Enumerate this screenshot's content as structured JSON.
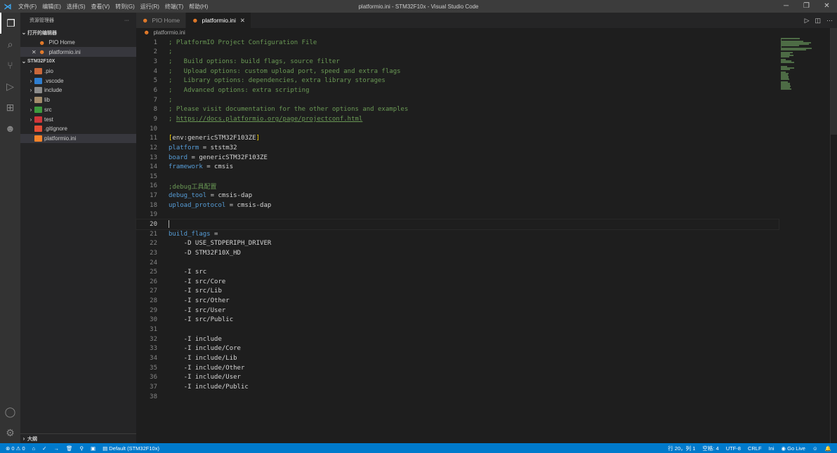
{
  "window": {
    "title": "platformio.ini - STM32F10x - Visual Studio Code",
    "menu": [
      "文件(F)",
      "编辑(E)",
      "选择(S)",
      "查看(V)",
      "转到(G)",
      "运行(R)",
      "终端(T)",
      "帮助(H)"
    ]
  },
  "sidebar": {
    "title": "资源管理器",
    "more": "···",
    "open_editors": "打开的编辑器",
    "open_items": [
      "PIO Home",
      "platformio.ini"
    ],
    "project": "STM32F10X",
    "tree": [
      {
        "label": ".pio",
        "folder": true,
        "color": "#c9683b"
      },
      {
        "label": ".vscode",
        "folder": true,
        "color": "#2f7fd1"
      },
      {
        "label": "include",
        "folder": true,
        "color": "#8c8c8c"
      },
      {
        "label": "lib",
        "folder": true,
        "color": "#a38c6c"
      },
      {
        "label": "src",
        "folder": true,
        "color": "#3e9a3e"
      },
      {
        "label": "test",
        "folder": true,
        "color": "#d0363a"
      },
      {
        "label": ".gitignore",
        "folder": false,
        "color": "#e44d34"
      },
      {
        "label": "platformio.ini",
        "folder": false,
        "color": "#f5822a"
      }
    ],
    "outline": "大纲"
  },
  "tabs": [
    {
      "label": "PIO Home",
      "active": false
    },
    {
      "label": "platformio.ini",
      "active": true
    }
  ],
  "breadcrumb": "platformio.ini",
  "code": [
    [
      [
        "c",
        "; PlatformIO Project Configuration File"
      ]
    ],
    [
      [
        "c",
        ";"
      ]
    ],
    [
      [
        "c",
        ";   Build options: build flags, source filter"
      ]
    ],
    [
      [
        "c",
        ";   Upload options: custom upload port, speed and extra flags"
      ]
    ],
    [
      [
        "c",
        ";   Library options: dependencies, extra library storages"
      ]
    ],
    [
      [
        "c",
        ";   Advanced options: extra scripting"
      ]
    ],
    [
      [
        "c",
        ";"
      ]
    ],
    [
      [
        "c",
        "; Please visit documentation for the other options and examples"
      ]
    ],
    [
      [
        "c",
        "; "
      ],
      [
        "u",
        "https://docs.platformio.org/page/projectconf.html"
      ]
    ],
    [],
    [
      [
        "b",
        "["
      ],
      [
        "v",
        "env:genericSTM32F103ZE"
      ],
      [
        "b",
        "]"
      ]
    ],
    [
      [
        "k",
        "platform"
      ],
      [
        "v",
        " = ststm32"
      ]
    ],
    [
      [
        "k",
        "board"
      ],
      [
        "v",
        " = genericSTM32F103ZE"
      ]
    ],
    [
      [
        "k",
        "framework"
      ],
      [
        "v",
        " = cmsis"
      ]
    ],
    [],
    [
      [
        "c",
        ";debug工具配置"
      ]
    ],
    [
      [
        "k",
        "debug_tool"
      ],
      [
        "v",
        " = cmsis-dap"
      ]
    ],
    [
      [
        "k",
        "upload_protocol"
      ],
      [
        "v",
        " = cmsis-dap"
      ]
    ],
    [],
    [],
    [
      [
        "k",
        "build_flags"
      ],
      [
        "v",
        " ="
      ]
    ],
    [
      [
        "v",
        "    -D USE_STDPERIPH_DRIVER"
      ]
    ],
    [
      [
        "v",
        "    -D STM32F10X_HD"
      ]
    ],
    [],
    [
      [
        "v",
        "    -I src"
      ]
    ],
    [
      [
        "v",
        "    -I src/Core"
      ]
    ],
    [
      [
        "v",
        "    -I src/Lib"
      ]
    ],
    [
      [
        "v",
        "    -I src/Other"
      ]
    ],
    [
      [
        "v",
        "    -I src/User"
      ]
    ],
    [
      [
        "v",
        "    -I src/Public"
      ]
    ],
    [],
    [
      [
        "v",
        "    -I include"
      ]
    ],
    [
      [
        "v",
        "    -I include/Core"
      ]
    ],
    [
      [
        "v",
        "    -I include/Lib"
      ]
    ],
    [
      [
        "v",
        "    -I include/Other"
      ]
    ],
    [
      [
        "v",
        "    -I include/User"
      ]
    ],
    [
      [
        "v",
        "    -I include/Public"
      ]
    ],
    []
  ],
  "cursor_line": 20,
  "status": {
    "errors": "0",
    "warnings": "0",
    "env": "Default (STM32F10x)",
    "position": "行 20，列 1",
    "spaces": "空格: 4",
    "encoding": "UTF-8",
    "eol": "CRLF",
    "language": "Ini",
    "golive": "Go Live"
  }
}
